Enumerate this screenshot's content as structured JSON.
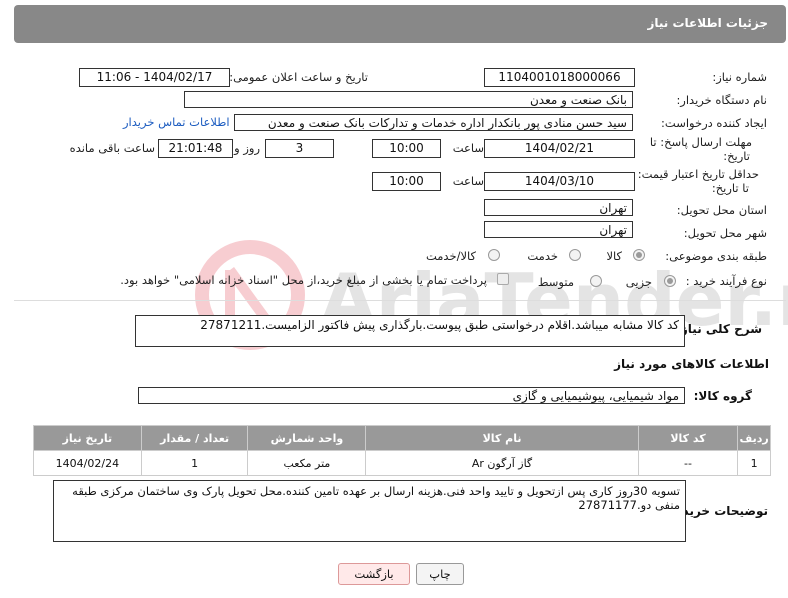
{
  "header": {
    "title": "جزئیات اطلاعات نیاز"
  },
  "form": {
    "need_number_label": "شماره نیاز:",
    "need_number": "1104001018000066",
    "announce_label": "تاریخ و ساعت اعلان عمومی:",
    "announce_value": "1404/02/17 - 11:06",
    "buyer_label": "نام دستگاه خریدار:",
    "buyer": "بانک صنعت و معدن",
    "creator_label": "ایجاد کننده درخواست:",
    "creator": "سید حسن منادی پور بانکدار اداره خدمات و تدارکات بانک صنعت و معدن",
    "contact_link": "اطلاعات تماس خریدار",
    "reply_deadline_label_1": "مهلت ارسال پاسخ: تا",
    "reply_deadline_label_2": "تاریخ:",
    "reply_date": "1404/02/21",
    "time_label": "ساعت",
    "reply_time": "10:00",
    "days_value": "3",
    "days_label": "روز و",
    "remaining_time": "21:01:48",
    "remaining_label": "ساعت باقی مانده",
    "price_validity_label_1": "حداقل تاریخ اعتبار قیمت:",
    "price_validity_label_2": "تا تاریخ:",
    "price_date": "1404/03/10",
    "price_time": "10:00",
    "province_label": "استان محل تحویل:",
    "province": "تهران",
    "city_label": "شهر محل تحویل:",
    "city": "تهران",
    "category_label": "طبقه بندی موضوعی:",
    "category_options": [
      "کالا",
      "خدمت",
      "کالا/خدمت"
    ],
    "process_label": "نوع فرآیند خرید :",
    "process_options": [
      "جزیی",
      "متوسط"
    ],
    "payment_note": "پرداخت تمام یا بخشی از مبلغ خرید،از محل \"اسناد خزانه اسلامی\" خواهد بود."
  },
  "description": {
    "label": "شرح کلی نیاز:",
    "text": "کد کالا مشابه میباشد.اقلام درخواستی طبق پیوست.بارگذاری پیش فاکتور الزامیست.27871211"
  },
  "items_section": {
    "title": "اطلاعات کالاهای مورد نیاز",
    "group_label": "گروه کالا:",
    "group_value": "مواد شیمیایی، پیوشیمیایی و  گازی"
  },
  "table": {
    "headers": [
      "ردیف",
      "کد کالا",
      "نام کالا",
      "واحد شمارش",
      "تعداد / مقدار",
      "تاریخ نیاز"
    ],
    "rows": [
      [
        "1",
        "--",
        "گاز آرگون Ar",
        "متر مکعب",
        "1",
        "1404/02/24"
      ]
    ]
  },
  "buyer_notes": {
    "label": "توضیحات خریدار:",
    "text": "تسویه 30روز کاری پس ازتحویل و تایید واحد فنی.هزینه ارسال بر عهده تامین کننده.محل تحویل پارک وی ساختمان مرکزی طبقه منفی دو.27871177"
  },
  "buttons": {
    "print": "چاپ",
    "back": "بازگشت"
  },
  "watermark": {
    "text": "AriaTender.neT"
  },
  "colors": {
    "header": "#888888",
    "link": "#1c5cc0",
    "back_button": "#ffe9e9"
  }
}
